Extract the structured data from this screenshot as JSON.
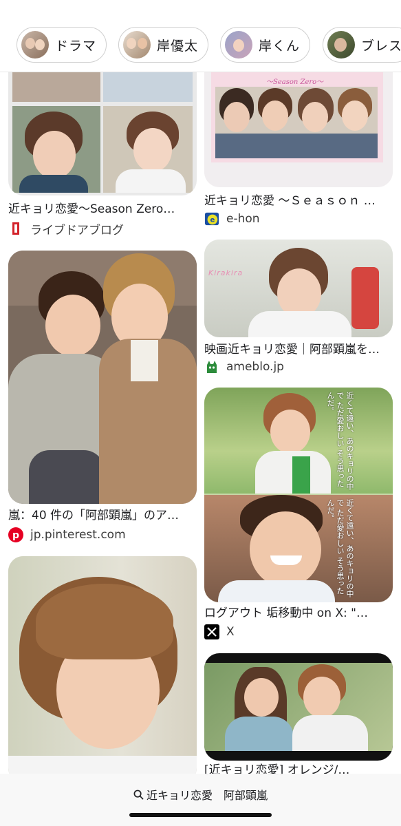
{
  "chips": [
    {
      "label": "ドラマ"
    },
    {
      "label": "岸優太"
    },
    {
      "label": "岸くん"
    },
    {
      "label": "ブレス"
    }
  ],
  "results": [
    {
      "title": "近キョリ恋愛〜Season Zero…",
      "source": "ライブドアブログ",
      "favicon": "livedoor-icon"
    },
    {
      "title": "近キョリ恋愛 〜Ｓｅａｓｏｎ …",
      "source": "e-hon",
      "favicon": "e-hon-icon"
    },
    {
      "title": "映画近キョリ恋愛｜阿部顕嵐を…",
      "source": "ameblo.jp",
      "favicon": "ameblo-icon"
    },
    {
      "title": "嵐：40 件の「阿部顕嵐」のア…",
      "source": "jp.pinterest.com",
      "favicon": "pinterest-icon"
    },
    {
      "title": "ログアウト 垢移動中 on X: \"…",
      "source": "X",
      "favicon": "x-icon"
    },
    {
      "title": "[近キョリ恋愛] オレンジ/…",
      "source": "",
      "favicon": ""
    }
  ],
  "image_text": {
    "season_zero_banner": "～Season Zero～",
    "kirakira": "Kirakira",
    "overlay_quote": "近くて遠い、あのキョリの中で ただ愛おしい そう思ったんだ。"
  },
  "search": {
    "query": "近キョリ恋愛　阿部顕嵐",
    "icon": "search-icon"
  },
  "colors": {
    "chip_border": "#cfcfcf",
    "pinterest_red": "#e60023",
    "ameblo_green": "#2d8c3c",
    "ehon_blue": "#1a4fa3"
  }
}
